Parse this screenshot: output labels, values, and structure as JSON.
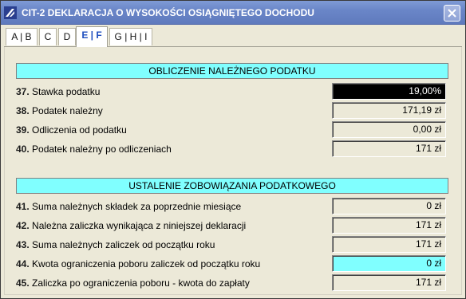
{
  "window": {
    "title": "CIT-2 DEKLARACJA O WYSOKOŚCI OSIĄGNIĘTEGO DOCHODU",
    "icon": "app-icon",
    "close_icon": "close-icon"
  },
  "tabs": [
    {
      "label": "A | B",
      "active": false
    },
    {
      "label": "C",
      "active": false
    },
    {
      "label": "D",
      "active": false
    },
    {
      "label": "E | F",
      "active": true
    },
    {
      "label": "G | H | I",
      "active": false
    }
  ],
  "section1": {
    "header": "OBLICZENIE NALEŻNEGO PODATKU",
    "rows": [
      {
        "num": "37.",
        "label": "Stawka podatku",
        "value": "19,00%"
      },
      {
        "num": "38.",
        "label": "Podatek należny",
        "value": "171,19 zł"
      },
      {
        "num": "39.",
        "label": "Odliczenia od podatku",
        "value": "0,00 zł"
      },
      {
        "num": "40.",
        "label": "Podatek należny po odliczeniach",
        "value": "171 zł"
      }
    ]
  },
  "section2": {
    "header": "USTALENIE ZOBOWIĄZANIA PODATKOWEGO",
    "rows": [
      {
        "num": "41.",
        "label": "Suma należnych składek za poprzednie miesiące",
        "value": "0 zł"
      },
      {
        "num": "42.",
        "label": "Należna zaliczka wynikająca z niniejszej deklaracji",
        "value": "171 zł"
      },
      {
        "num": "43.",
        "label": "Suma należnych zaliczek od początku roku",
        "value": "171 zł"
      },
      {
        "num": "44.",
        "label": "Kwota ograniczenia poboru zaliczek od początku roku",
        "value": "0 zł"
      },
      {
        "num": "45.",
        "label": "Zaliczka po ograniczenia poboru - kwota do zapłaty",
        "value": "171 zł"
      }
    ]
  },
  "colors": {
    "title_bar": "#6a86c8",
    "section_header_bg": "#80ffff",
    "active_tab_text": "#1f4fbf",
    "highlight_field": "#80ffff",
    "selected_field": "#000000"
  }
}
